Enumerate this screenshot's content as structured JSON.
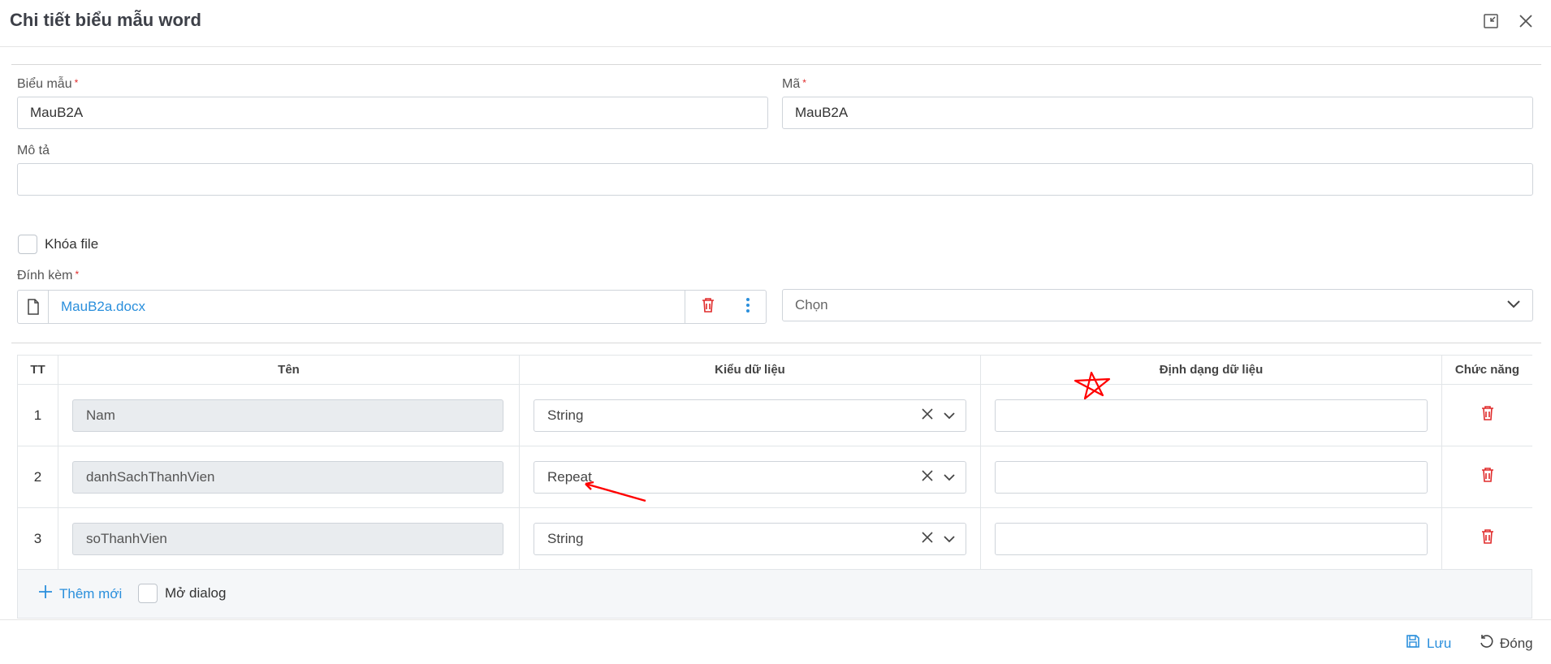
{
  "header": {
    "title": "Chi tiết biểu mẫu word",
    "minimize_icon": "collapse-icon",
    "close_icon": "close-icon"
  },
  "form": {
    "template_label": "Biểu mẫu",
    "template_value": "MauB2A",
    "code_label": "Mã",
    "code_value": "MauB2A",
    "desc_label": "Mô tả",
    "desc_value": "",
    "lock_label": "Khóa file",
    "attach_label": "Đính kèm",
    "attach_file": "MauB2a.docx",
    "choose_placeholder": "Chọn",
    "required_mark": "*"
  },
  "table": {
    "headers": [
      "TT",
      "Tên",
      "Kiểu dữ liệu",
      "Định dạng dữ liệu",
      "Chức năng"
    ],
    "rows": [
      {
        "index": "1",
        "name": "Nam",
        "type": "String",
        "format": ""
      },
      {
        "index": "2",
        "name": "danhSachThanhVien",
        "type": "Repeat",
        "format": ""
      },
      {
        "index": "3",
        "name": "soThanhVien",
        "type": "String",
        "format": ""
      }
    ],
    "add_label": "Thêm mới",
    "dialog_label": "Mở dialog"
  },
  "footer": {
    "save_label": "Lưu",
    "close_label": "Đóng"
  },
  "colors": {
    "accent": "#2a8fdc",
    "danger": "#e02b2b",
    "annotation": "#ff0000"
  }
}
